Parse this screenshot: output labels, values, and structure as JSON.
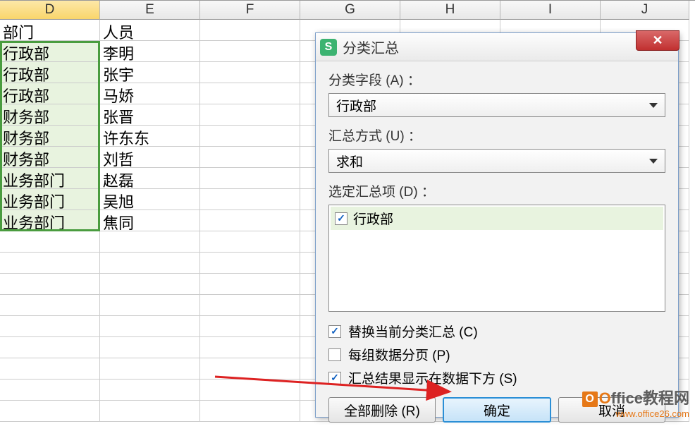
{
  "columns": [
    "D",
    "E",
    "F",
    "G",
    "H",
    "I",
    "J"
  ],
  "selected_column": "D",
  "grid": {
    "header_row": {
      "d": "部门",
      "e": "人员"
    },
    "rows": [
      {
        "d": "行政部",
        "e": "李明"
      },
      {
        "d": "行政部",
        "e": "张宇"
      },
      {
        "d": "行政部",
        "e": "马娇"
      },
      {
        "d": "财务部",
        "e": "张晋"
      },
      {
        "d": "财务部",
        "e": "许东东"
      },
      {
        "d": "财务部",
        "e": "刘哲"
      },
      {
        "d": "业务部门",
        "e": "赵磊"
      },
      {
        "d": "业务部门",
        "e": "吴旭"
      },
      {
        "d": "业务部门",
        "e": "焦同"
      }
    ]
  },
  "dialog": {
    "title": "分类汇总",
    "close_x": "✕",
    "field_label": "分类字段 (A) ：",
    "field_value": "行政部",
    "method_label": "汇总方式 (U) ：",
    "method_value": "求和",
    "items_label": "选定汇总项 (D) ：",
    "items": [
      {
        "label": "行政部",
        "checked": true
      }
    ],
    "checkboxes": [
      {
        "label": "替换当前分类汇总 (C)",
        "checked": true
      },
      {
        "label": "每组数据分页 (P)",
        "checked": false
      },
      {
        "label": "汇总结果显示在数据下方 (S)",
        "checked": true
      }
    ],
    "buttons": {
      "remove_all": "全部删除 (R)",
      "ok": "确定",
      "cancel": "取消"
    }
  },
  "watermark": {
    "line1_prefix": "O",
    "line1_mid": "ffice",
    "line1_suffix": "教程网",
    "line2": "www.office26.com"
  }
}
